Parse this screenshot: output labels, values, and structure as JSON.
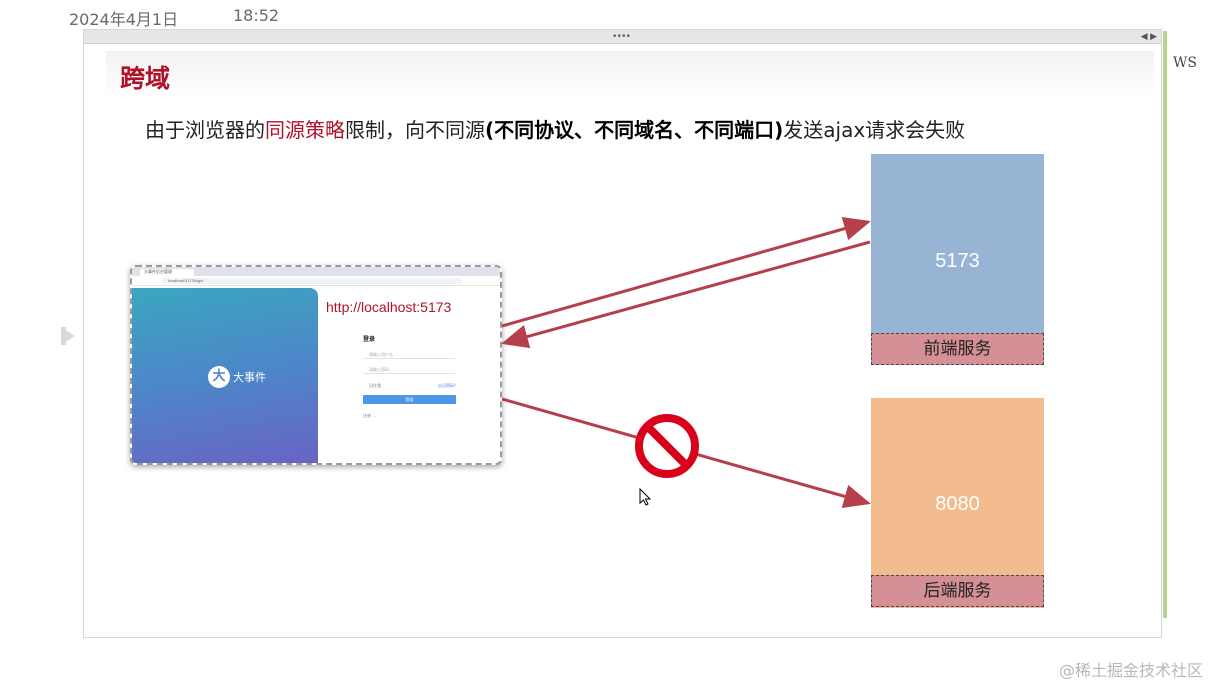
{
  "note": {
    "date": "2024年4月1日",
    "time": "18:52",
    "side_label": "WS"
  },
  "slide": {
    "title": "跨域",
    "subtitle": {
      "part1": "由于浏览器的",
      "highlight": "同源策略",
      "part2": "限制，向不同源",
      "bold": "(不同协议、不同域名、不同端口)",
      "part3": "发送ajax请求会失败"
    }
  },
  "browser": {
    "tab_title": "大事件后台管理",
    "url": "localhost:5173/login",
    "address_caption": "http://localhost:5173",
    "logo_mark": "大",
    "logo_text": "大事件",
    "login_title": "登录",
    "username_placeholder": "请输入用户名",
    "password_placeholder": "请输入密码",
    "remember": "记住我",
    "forgot": "忘记密码？",
    "login_button": "登录",
    "register_link": "注册 →"
  },
  "servers": {
    "front": {
      "port": "5173",
      "label": "前端服务",
      "color": "#98b4d4"
    },
    "back": {
      "port": "8080",
      "label": "后端服务",
      "color": "#f3bc8e"
    }
  },
  "colors": {
    "accent_red": "#b0122a",
    "arrow": "#b5404b",
    "forbidden": "#d9001b"
  },
  "watermark": "@稀土掘金技术社区"
}
